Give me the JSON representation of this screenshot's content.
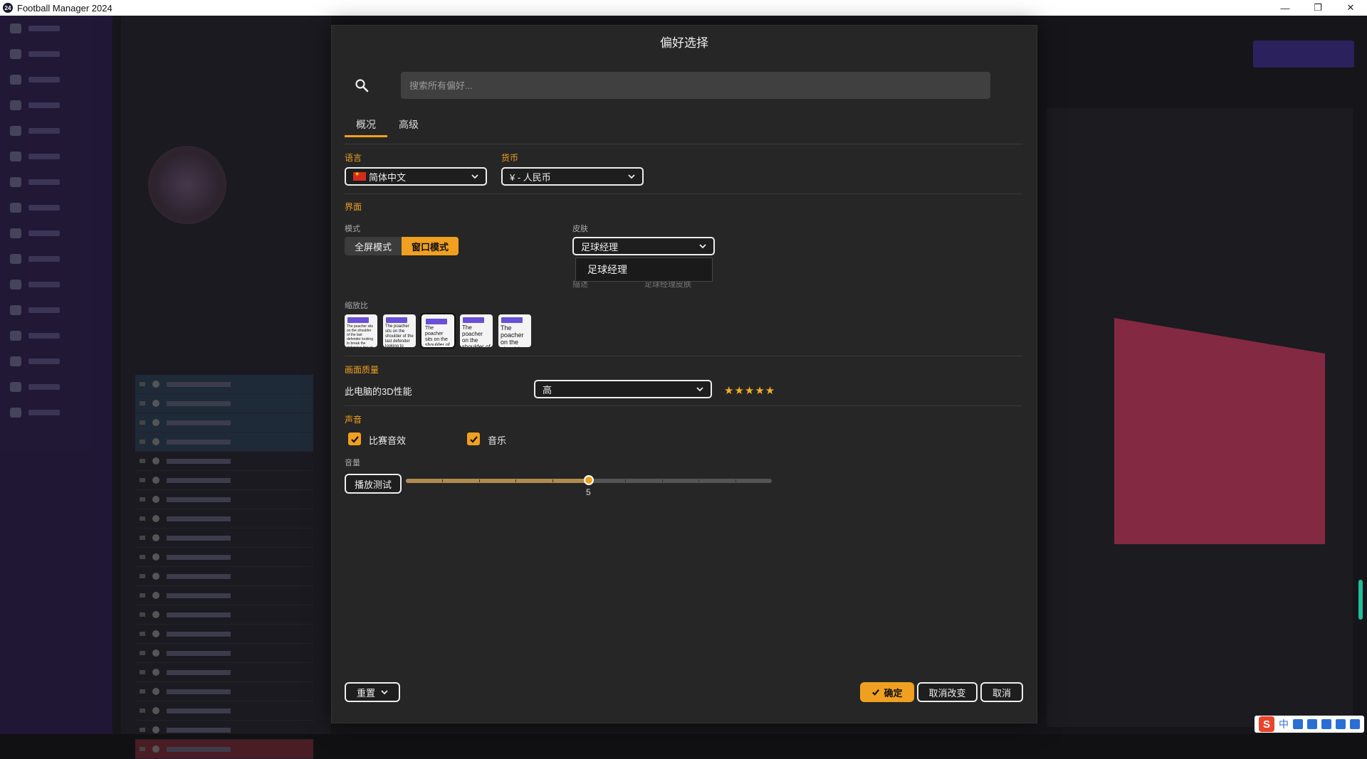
{
  "window": {
    "title": "Football Manager 2024",
    "app_icon": "24"
  },
  "dialog": {
    "title": "偏好选择",
    "search": {
      "placeholder": "搜索所有偏好..."
    },
    "tabs": [
      {
        "label": "概况",
        "active": true
      },
      {
        "label": "高级",
        "active": false
      }
    ],
    "language": {
      "label": "语言",
      "value": "简体中文"
    },
    "currency": {
      "label": "货币",
      "value": "¥ - 人民币"
    },
    "interface": {
      "label": "界面",
      "mode_label": "模式",
      "mode_options": [
        "全屏模式",
        "窗口模式"
      ],
      "mode_selected": "窗口模式",
      "skin_label": "皮肤",
      "skin_value": "足球经理",
      "skin_menu_items": [
        "足球经理"
      ],
      "behind_left": "描述",
      "behind_right": "足球经理皮肤"
    },
    "scale": {
      "label": "缩放比",
      "thumbs": [
        {
          "tag": "FM",
          "text": "The poacher sits on the shoulder of the last defender looking to break the defensive line at the back before"
        },
        {
          "tag": "FM",
          "text": "The poacher sits on the shoulder of the last defender looking to break the defensive"
        },
        {
          "tag": "FM",
          "text": "The poacher sits on the shoulder of the last defender to break"
        },
        {
          "tag": "FM",
          "text": "The poacher on the shoulder of the last defender"
        },
        {
          "tag": "FM",
          "text": "The poacher on the shoulder of the last"
        }
      ],
      "selected_index": 2
    },
    "quality": {
      "label": "画面质量",
      "perf_label": "此电脑的3D性能",
      "perf_value": "高",
      "stars": "★★★★★",
      "rating": 5
    },
    "sound": {
      "label": "声音",
      "match_sfx": "比赛音效",
      "music": "音乐",
      "volume_label": "音量",
      "test_button": "播放测试",
      "volume_value": "5",
      "volume_fraction": 0.5
    },
    "footer": {
      "reset": "重置",
      "confirm": "确定",
      "revert": "取消改变",
      "cancel": "取消"
    }
  },
  "ime": {
    "lang": "中"
  },
  "colors": {
    "accent": "#f0a020",
    "dialog_bg": "#262626",
    "sidebar": "#2a1a4d"
  }
}
